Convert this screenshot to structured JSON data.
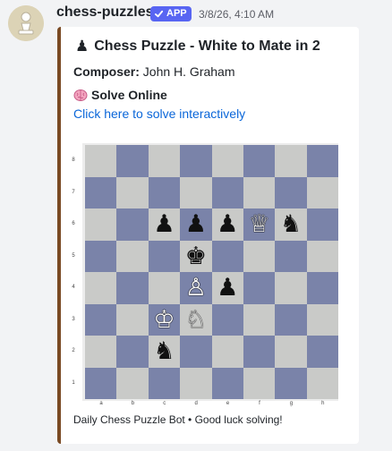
{
  "message": {
    "username": "chess-puzzles",
    "badge": "APP",
    "timestamp": "3/8/26, 4:10 AM",
    "avatar_icon": "pawn-icon"
  },
  "embed": {
    "accent_color": "#7a4a24",
    "title_icon": "♟",
    "title": "Chess Puzzle - White to Mate in 2",
    "composer_label": "Composer:",
    "composer_name": "John H. Graham",
    "solve_icon": "brain-icon",
    "solve_label": "Solve Online",
    "solve_link": "Click here to solve interactively",
    "footer": "Daily Chess Puzzle Bot • Good luck solving!"
  },
  "board": {
    "ranks": [
      "8",
      "7",
      "6",
      "5",
      "4",
      "3",
      "2",
      "1"
    ],
    "files": [
      "a",
      "b",
      "c",
      "d",
      "e",
      "f",
      "g",
      "h"
    ],
    "light_color": "#c9cac8",
    "dark_color": "#7a83a9",
    "pieces": [
      {
        "square": "c6",
        "glyph": "♟",
        "color": "black",
        "name": "black-pawn"
      },
      {
        "square": "d6",
        "glyph": "♟",
        "color": "black",
        "name": "black-pawn"
      },
      {
        "square": "e6",
        "glyph": "♟",
        "color": "black",
        "name": "black-pawn"
      },
      {
        "square": "f6",
        "glyph": "♕",
        "color": "white",
        "name": "white-queen"
      },
      {
        "square": "g6",
        "glyph": "♞",
        "color": "black",
        "name": "black-knight"
      },
      {
        "square": "d5",
        "glyph": "♚",
        "color": "black",
        "name": "black-king"
      },
      {
        "square": "d4",
        "glyph": "♙",
        "color": "white",
        "name": "white-pawn"
      },
      {
        "square": "e4",
        "glyph": "♟",
        "color": "black",
        "name": "black-pawn"
      },
      {
        "square": "c3",
        "glyph": "♔",
        "color": "white",
        "name": "white-king"
      },
      {
        "square": "d3",
        "glyph": "♘",
        "color": "white",
        "name": "white-knight"
      },
      {
        "square": "c2",
        "glyph": "♞",
        "color": "black",
        "name": "black-knight"
      }
    ]
  }
}
